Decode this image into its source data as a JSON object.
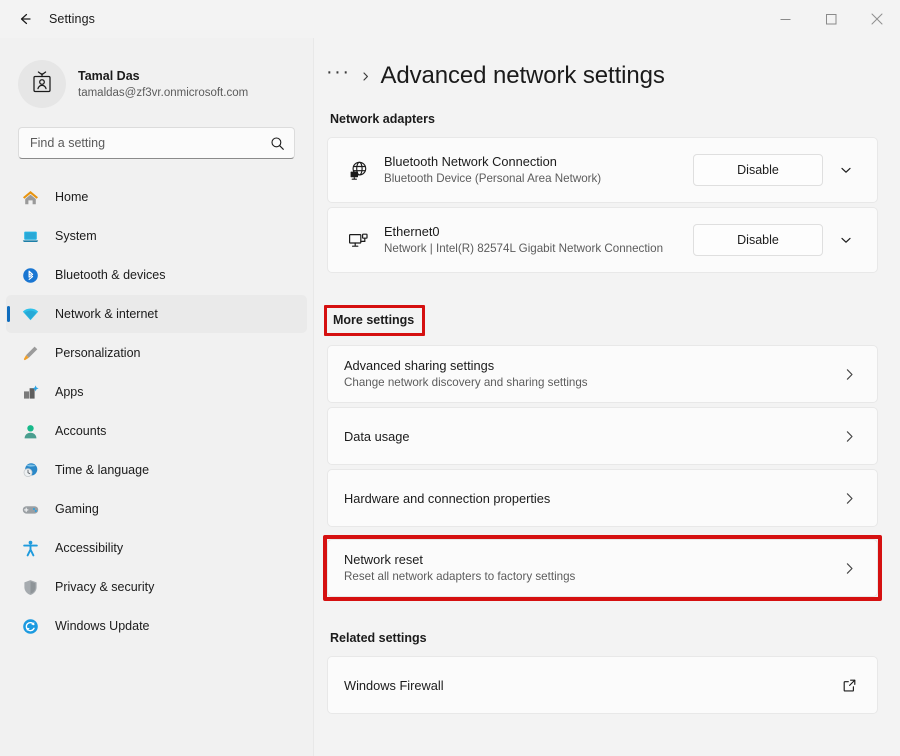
{
  "window": {
    "app_title": "Settings",
    "back_icon": "back-arrow-icon",
    "minimize_label": "Minimize",
    "maximize_label": "Maximize",
    "close_label": "Close"
  },
  "sidebar": {
    "profile": {
      "name": "Tamal Das",
      "email": "tamaldas@zf3vr.onmicrosoft.com",
      "avatar_icon": "account-badge-icon"
    },
    "search": {
      "placeholder": "Find a setting",
      "value": "",
      "icon": "search-icon"
    },
    "items": [
      {
        "label": "Home",
        "icon": "home-icon",
        "selected": false
      },
      {
        "label": "System",
        "icon": "system-laptop-icon",
        "selected": false
      },
      {
        "label": "Bluetooth & devices",
        "icon": "bluetooth-icon",
        "selected": false
      },
      {
        "label": "Network & internet",
        "icon": "wifi-icon",
        "selected": true
      },
      {
        "label": "Personalization",
        "icon": "paintbrush-icon",
        "selected": false
      },
      {
        "label": "Apps",
        "icon": "apps-icon",
        "selected": false
      },
      {
        "label": "Accounts",
        "icon": "person-icon",
        "selected": false
      },
      {
        "label": "Time & language",
        "icon": "clock-globe-icon",
        "selected": false
      },
      {
        "label": "Gaming",
        "icon": "gamepad-icon",
        "selected": false
      },
      {
        "label": "Accessibility",
        "icon": "accessibility-icon",
        "selected": false
      },
      {
        "label": "Privacy & security",
        "icon": "shield-icon",
        "selected": false
      },
      {
        "label": "Windows Update",
        "icon": "update-refresh-icon",
        "selected": false
      }
    ]
  },
  "main": {
    "breadcrumb_overflow": "···",
    "breadcrumb_separator": "chevron-right-icon",
    "page_title": "Advanced network settings",
    "sections": {
      "network_adapters": {
        "heading": "Network adapters",
        "adapters": [
          {
            "name": "Bluetooth Network Connection",
            "description": "Bluetooth Device (Personal Area Network)",
            "icon": "network-globe-icon",
            "action_label": "Disable",
            "expander_icon": "chevron-down-icon"
          },
          {
            "name": "Ethernet0",
            "description": "Network | Intel(R) 82574L Gigabit Network Connection",
            "icon": "ethernet-monitor-icon",
            "action_label": "Disable",
            "expander_icon": "chevron-down-icon"
          }
        ]
      },
      "more_settings": {
        "heading": "More settings",
        "heading_highlighted": true,
        "rows": [
          {
            "title": "Advanced sharing settings",
            "description": "Change network discovery and sharing settings",
            "chevron_icon": "chevron-right-icon",
            "highlighted": false
          },
          {
            "title": "Data usage",
            "description": "",
            "chevron_icon": "chevron-right-icon",
            "highlighted": false
          },
          {
            "title": "Hardware and connection properties",
            "description": "",
            "chevron_icon": "chevron-right-icon",
            "highlighted": false
          },
          {
            "title": "Network reset",
            "description": "Reset all network adapters to factory settings",
            "chevron_icon": "chevron-right-icon",
            "highlighted": true
          }
        ]
      },
      "related_settings": {
        "heading": "Related settings",
        "rows": [
          {
            "title": "Windows Firewall",
            "description": "",
            "icon": "external-link-icon"
          }
        ]
      }
    }
  },
  "colors": {
    "accent": "#0f6cbd",
    "highlight": "#d51010",
    "sidebar_bg": "#f1f1f1",
    "content_bg": "#f3f3f3",
    "card_bg": "#fbfbfb"
  }
}
